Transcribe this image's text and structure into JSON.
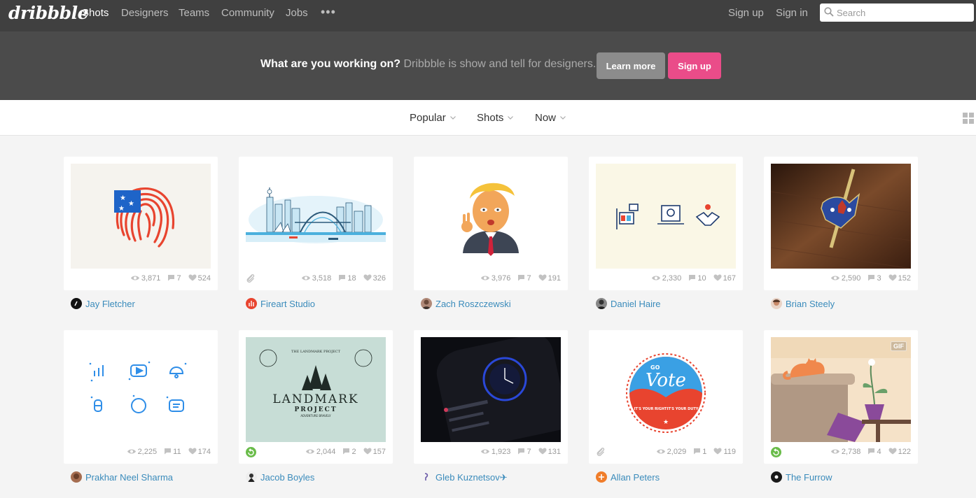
{
  "nav": {
    "logo": "dribbble",
    "links": [
      "Shots",
      "Designers",
      "Teams",
      "Community",
      "Jobs"
    ],
    "more": "•••",
    "sign_up": "Sign up",
    "sign_in": "Sign in",
    "search_placeholder": "Search"
  },
  "banner": {
    "question": "What are you working on?",
    "subtitle": " Dribbble is show and tell for designers.",
    "learn_more": "Learn more",
    "sign_up": "Sign up"
  },
  "filters": {
    "sort": "Popular",
    "type": "Shots",
    "time": "Now"
  },
  "colors": {
    "pink": "#ea4c89",
    "link": "#3a8bbb",
    "nav_bg": "#404040",
    "banner_bg": "#4b4b4b"
  },
  "shots": [
    {
      "author": "Jay Fletcher",
      "views": "3,871",
      "comments": "7",
      "likes": "524",
      "badge": "none"
    },
    {
      "author": "Fireart Studio",
      "views": "3,518",
      "comments": "18",
      "likes": "326",
      "badge": "attachment"
    },
    {
      "author": "Zach Roszczewski",
      "views": "3,976",
      "comments": "7",
      "likes": "191",
      "badge": "none"
    },
    {
      "author": "Daniel Haire",
      "views": "2,330",
      "comments": "10",
      "likes": "167",
      "badge": "none"
    },
    {
      "author": "Brian Steely",
      "views": "2,590",
      "comments": "3",
      "likes": "152",
      "badge": "none"
    },
    {
      "author": "Prakhar Neel Sharma",
      "views": "2,225",
      "comments": "11",
      "likes": "174",
      "badge": "none"
    },
    {
      "author": "Jacob Boyles",
      "views": "2,044",
      "comments": "2",
      "likes": "157",
      "badge": "rebound",
      "art_text": {
        "top": "THE LANDMARK PROJECT",
        "title": "LANDMARK",
        "subtitle": "PROJECT",
        "tagline": "ADVENTURE BRAVELY"
      }
    },
    {
      "author": "Gleb Kuznetsov✈",
      "views": "1,923",
      "comments": "7",
      "likes": "131",
      "badge": "none"
    },
    {
      "author": "Allan Peters",
      "views": "2,029",
      "comments": "1",
      "likes": "119",
      "badge": "attachment",
      "art_text": {
        "go": "GO",
        "vote": "Vote",
        "left": "IT'S YOUR RIGHT",
        "right": "IT'S YOUR DUTY"
      }
    },
    {
      "author": "The Furrow",
      "views": "2,738",
      "comments": "4",
      "likes": "122",
      "badge": "rebound",
      "gif": "GIF"
    }
  ]
}
